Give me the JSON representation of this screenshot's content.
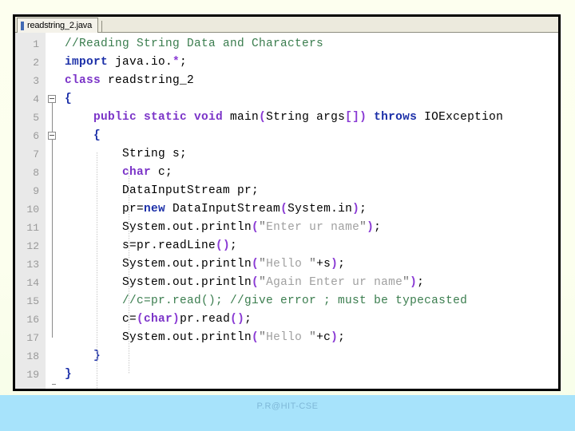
{
  "window": {
    "tab_label": "readstring_2.java",
    "tab_icon": "java-file-icon"
  },
  "editor": {
    "line_numbers": [
      "1",
      "2",
      "3",
      "4",
      "5",
      "6",
      "7",
      "8",
      "9",
      "10",
      "11",
      "12",
      "13",
      "14",
      "15",
      "16",
      "17",
      "18",
      "19"
    ],
    "lines": [
      {
        "n": "1",
        "text": "//Reading String Data and Characters"
      },
      {
        "n": "2",
        "text": "import java.io.*;"
      },
      {
        "n": "3",
        "text": "class readstring_2"
      },
      {
        "n": "4",
        "text": "{"
      },
      {
        "n": "5",
        "text": "    public static void main(String args[]) throws IOException"
      },
      {
        "n": "6",
        "text": "    {"
      },
      {
        "n": "7",
        "text": "        String s;"
      },
      {
        "n": "8",
        "text": "        char c;"
      },
      {
        "n": "9",
        "text": "        DataInputStream pr;"
      },
      {
        "n": "10",
        "text": "        pr=new DataInputStream(System.in);"
      },
      {
        "n": "11",
        "text": "        System.out.println(\"Enter ur name\");"
      },
      {
        "n": "12",
        "text": "        s=pr.readLine();"
      },
      {
        "n": "13",
        "text": "        System.out.println(\"Hello \"+s);"
      },
      {
        "n": "14",
        "text": "        System.out.println(\"Again Enter ur name\");"
      },
      {
        "n": "15",
        "text": "        //c=pr.read(); //give error ; must be typecasted"
      },
      {
        "n": "16",
        "text": "        c=(char)pr.read();"
      },
      {
        "n": "17",
        "text": "        System.out.println(\"Hello \"+c);"
      },
      {
        "n": "18",
        "text": "    }"
      },
      {
        "n": "19",
        "text": "}"
      }
    ],
    "fold_markers": [
      {
        "line": "4",
        "type": "collapse-box"
      },
      {
        "line": "6",
        "type": "collapse-box"
      },
      {
        "line": "18",
        "type": "fold-end"
      },
      {
        "line": "19",
        "type": "fold-end"
      }
    ]
  },
  "footer": {
    "credit": "P.R@HIT-CSE"
  },
  "colors": {
    "slide_background": "#fdffef",
    "editor_background": "#ffffff",
    "gutter_background": "#e9e9e9",
    "tab_strip_background": "#eceadd",
    "footer_band": "#a7e3fb",
    "comment": "#3a7d4e",
    "keyword": "#7b34c8",
    "keyword_blue": "#1b2fa8",
    "string": "#a0a0a0",
    "paren": "#8a3bd4",
    "brace": "#1b2fa8",
    "line_number": "#9a9a9a",
    "footer_text": "#7fb8d8"
  }
}
